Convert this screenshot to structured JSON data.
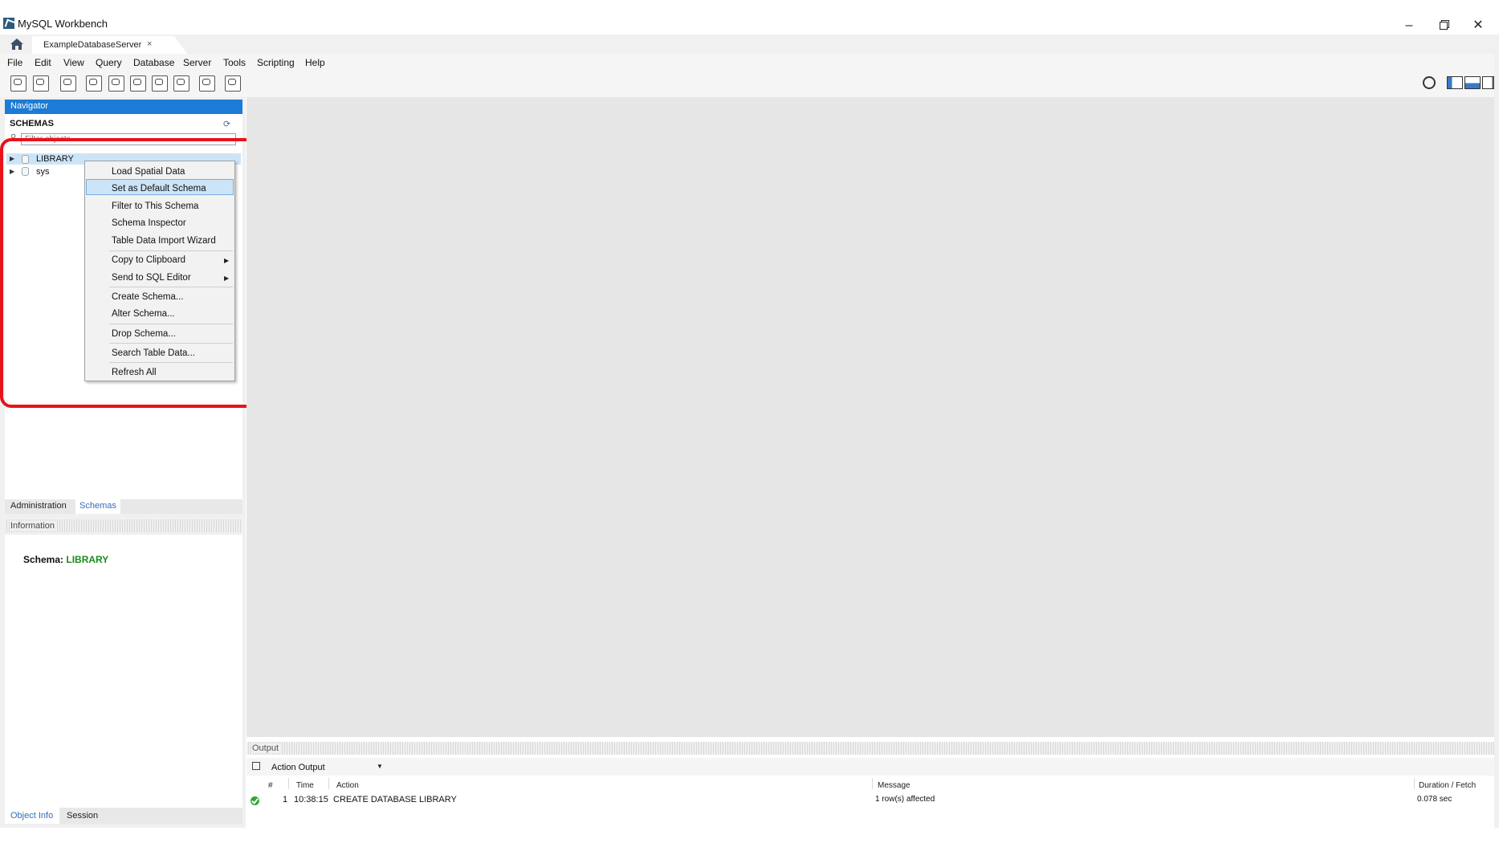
{
  "window": {
    "title": "MySQL Workbench",
    "controls": [
      "minimize-icon",
      "restore-icon",
      "close-icon"
    ]
  },
  "tabs": {
    "home_icon": "home-icon",
    "active_tab": "ExampleDatabaseServer",
    "close_glyph": "×"
  },
  "menubar": {
    "items": [
      "File",
      "Edit",
      "View",
      "Query",
      "Database",
      "Server",
      "Tools",
      "Scripting",
      "Help"
    ]
  },
  "toolbar": {
    "icons": [
      "new-sql-tab-icon",
      "open-sql-script-icon",
      "inspect-object-icon",
      "create-schema-icon",
      "create-table-icon",
      "create-view-icon",
      "create-procedure-icon",
      "create-function-icon",
      "search-table-data-icon",
      "reconnect-icon"
    ],
    "right_icons": [
      "settings-icon",
      "toggle-sidebar-icon",
      "toggle-output-icon",
      "toggle-secondary-sidebar-icon"
    ]
  },
  "navigator": {
    "header": "Navigator",
    "schemas_label": "SCHEMAS",
    "filter_placeholder": "Filter objects",
    "tree": [
      {
        "label": "LIBRARY",
        "selected": true
      },
      {
        "label": "sys",
        "selected": false
      }
    ]
  },
  "context_menu": {
    "groups": [
      [
        "Load Spatial Data",
        "Set as Default Schema",
        "Filter to This Schema",
        "Schema Inspector",
        "Table Data Import Wizard"
      ],
      [
        "Copy to Clipboard",
        "Send to SQL Editor"
      ],
      [
        "Create Schema...",
        "Alter Schema..."
      ],
      [
        "Drop Schema..."
      ],
      [
        "Search Table Data..."
      ],
      [
        "Refresh All"
      ]
    ],
    "highlighted": "Set as Default Schema",
    "submenu_items": [
      "Copy to Clipboard",
      "Send to SQL Editor"
    ]
  },
  "left_tabs": {
    "administration": "Administration",
    "schemas": "Schemas",
    "active": "Schemas"
  },
  "information": {
    "header": "Information",
    "schema_label": "Schema:",
    "schema_value": "LIBRARY"
  },
  "bottom_tabs": {
    "object_info": "Object Info",
    "session": "Session",
    "active": "Object Info"
  },
  "output": {
    "header": "Output",
    "selector": "Action Output",
    "columns": [
      "#",
      "Time",
      "Action",
      "Message",
      "Duration / Fetch"
    ],
    "rows": [
      {
        "status": "success",
        "num": "1",
        "time": "10:38:15",
        "action": "CREATE DATABASE LIBRARY",
        "message": "1 row(s) affected",
        "duration": "0.078 sec"
      }
    ]
  },
  "colors": {
    "navigator_header": "#1c7bd4",
    "selection": "#cce4f7",
    "annotation_red": "#e8121b",
    "schema_value_green": "#1d8a1d",
    "success_green": "#2fa82f"
  }
}
